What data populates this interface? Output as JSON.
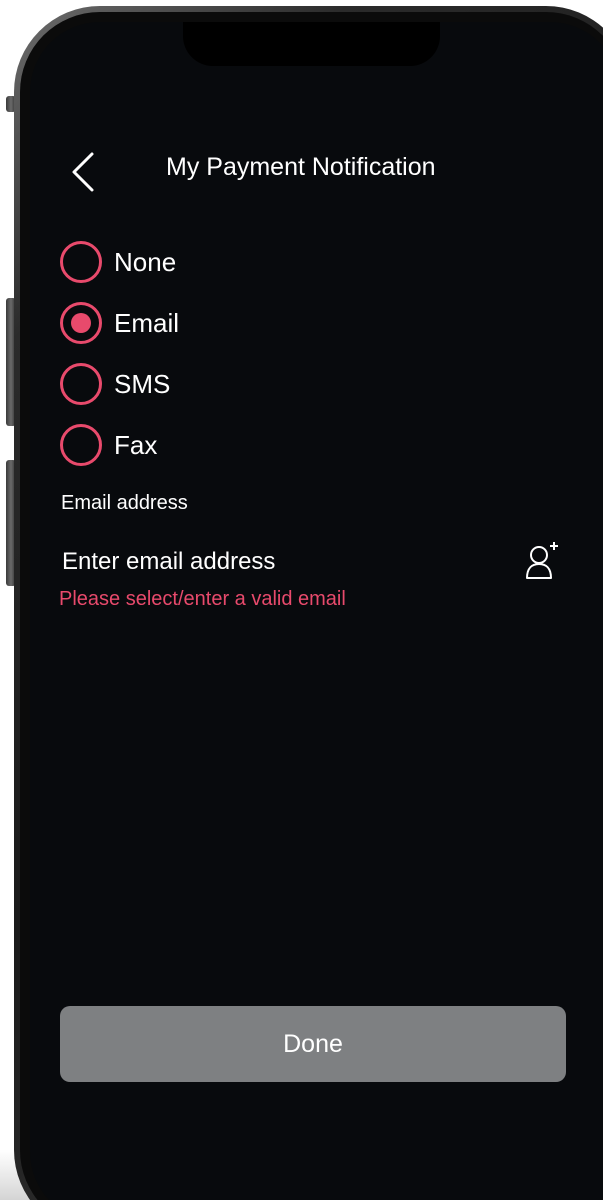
{
  "header": {
    "title": "My Payment Notification",
    "back_icon": "chevron-left-icon"
  },
  "notification_options": [
    {
      "label": "None",
      "selected": false
    },
    {
      "label": "Email",
      "selected": true
    },
    {
      "label": "SMS",
      "selected": false
    },
    {
      "label": "Fax",
      "selected": false
    }
  ],
  "email": {
    "label": "Email address",
    "placeholder": "Enter email address",
    "value": "",
    "contact_icon": "add-contact-icon",
    "error": "Please select/enter a valid email"
  },
  "footer": {
    "done_label": "Done"
  },
  "colors": {
    "accent": "#e84a6c",
    "screen_background": "#080a0d",
    "done_button": "#7e8082",
    "text": "#ffffff"
  }
}
